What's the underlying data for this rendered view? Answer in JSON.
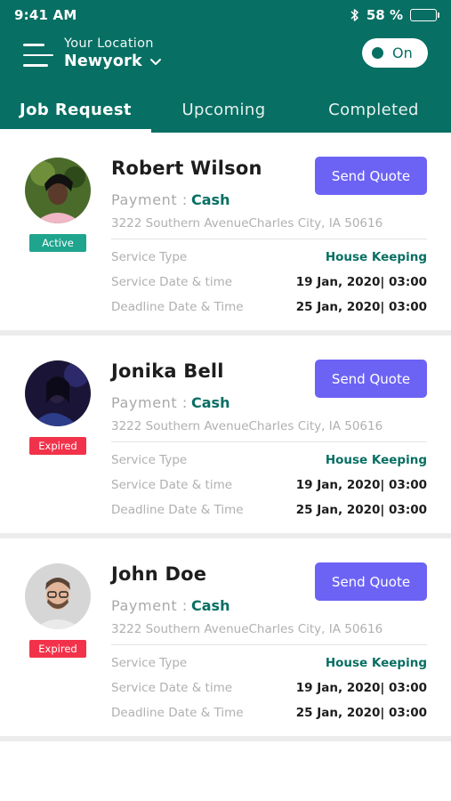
{
  "status_bar": {
    "time": "9:41 AM",
    "battery": "58 %",
    "battery_level": 0.58
  },
  "header": {
    "location_caption": "Your Location",
    "location_city": "Newyork",
    "toggle_label": "On",
    "colors": {
      "primary": "#076f63",
      "accent": "#6c63f5",
      "active": "#1fa48e",
      "expired": "#f2324a"
    }
  },
  "tabs": [
    {
      "label": "Job Request",
      "active": true
    },
    {
      "label": "Upcoming",
      "active": false
    },
    {
      "label": "Completed",
      "active": false
    }
  ],
  "jobs": [
    {
      "name": "Robert Wilson",
      "status": "Active",
      "quote_label": "Send Quote",
      "payment_label": "Payment :",
      "payment_value": "Cash",
      "address": "3222 Southern AvenueCharles City, IA 50616",
      "service_type_label": "Service Type",
      "service_type": "House Keeping",
      "service_date_label": "Service Date & time",
      "service_date": "19 Jan, 2020| 03:00",
      "deadline_label": "Deadline Date & Time",
      "deadline": "25 Jan, 2020| 03:00"
    },
    {
      "name": "Jonika Bell",
      "status": "Expired",
      "quote_label": "Send Quote",
      "payment_label": "Payment :",
      "payment_value": "Cash",
      "address": "3222 Southern AvenueCharles City, IA 50616",
      "service_type_label": "Service Type",
      "service_type": "House Keeping",
      "service_date_label": "Service Date & time",
      "service_date": "19 Jan, 2020| 03:00",
      "deadline_label": "Deadline Date & Time",
      "deadline": "25 Jan, 2020| 03:00"
    },
    {
      "name": "John Doe",
      "status": "Expired",
      "quote_label": "Send Quote",
      "payment_label": "Payment :",
      "payment_value": "Cash",
      "address": "3222 Southern AvenueCharles City, IA 50616",
      "service_type_label": "Service Type",
      "service_type": "House Keeping",
      "service_date_label": "Service Date & time",
      "service_date": "19 Jan, 2020| 03:00",
      "deadline_label": "Deadline Date & Time",
      "deadline": "25 Jan, 2020| 03:00"
    }
  ]
}
